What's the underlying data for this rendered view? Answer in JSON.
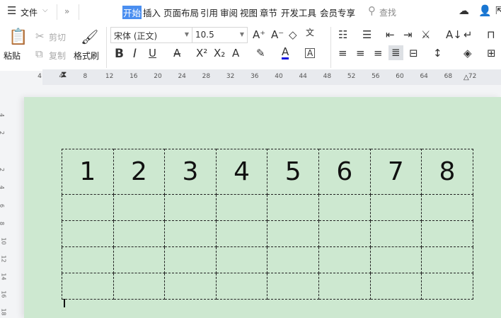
{
  "menu": {
    "file": "文件",
    "more": "»"
  },
  "tabs": [
    "开始",
    "插入",
    "页面布局",
    "引用",
    "审阅",
    "视图",
    "章节",
    "开发工具",
    "会员专享"
  ],
  "search": "查找",
  "clipboard": {
    "paste": "粘贴",
    "cut": "剪切",
    "copy": "复制",
    "format_painter": "格式刷"
  },
  "font": {
    "name": "宋体 (正文)",
    "size": "10.5"
  },
  "ruler": {
    "h": [
      "4",
      "4",
      "8",
      "12",
      "16",
      "20",
      "24",
      "28",
      "32",
      "36",
      "40",
      "44",
      "48",
      "52",
      "56",
      "60",
      "64",
      "68",
      "72"
    ],
    "v": [
      "4",
      "2",
      "2",
      "4",
      "6",
      "8",
      "10",
      "12",
      "14",
      "16",
      "18"
    ]
  },
  "table": {
    "header": [
      "1",
      "2",
      "3",
      "4",
      "5",
      "6",
      "7",
      "8"
    ],
    "empty_rows": 4
  }
}
